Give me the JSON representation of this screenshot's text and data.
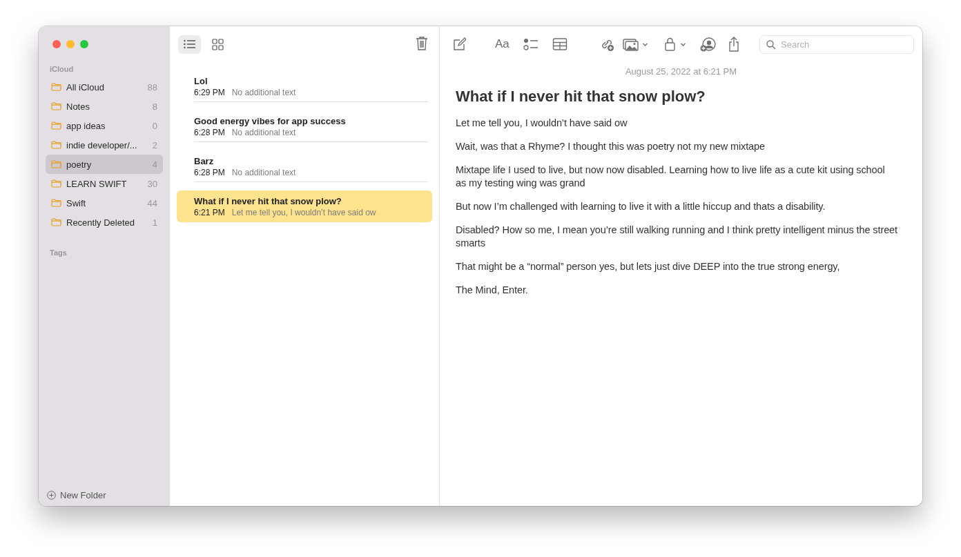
{
  "sidebar": {
    "section": "iCloud",
    "folders": [
      {
        "name": "All iCloud",
        "count": "88",
        "selected": false
      },
      {
        "name": "Notes",
        "count": "8",
        "selected": false
      },
      {
        "name": "app ideas",
        "count": "0",
        "selected": false
      },
      {
        "name": "indie developer/...",
        "count": "2",
        "selected": false
      },
      {
        "name": "poetry",
        "count": "4",
        "selected": true
      },
      {
        "name": "LEARN SWIFT",
        "count": "30",
        "selected": false
      },
      {
        "name": "Swift",
        "count": "44",
        "selected": false
      },
      {
        "name": "Recently Deleted",
        "count": "1",
        "selected": false
      }
    ],
    "tags_heading": "Tags",
    "new_folder": "New Folder"
  },
  "list_toolbar": {
    "views": [
      {
        "kind": "list",
        "selected": true
      },
      {
        "kind": "gallery",
        "selected": false
      }
    ]
  },
  "notes": [
    {
      "title": "Lol",
      "time": "6:29 PM",
      "preview": "No additional text",
      "selected": false
    },
    {
      "title": "Good energy vibes for app success",
      "time": "6:28 PM",
      "preview": "No additional text",
      "selected": false
    },
    {
      "title": "Barz",
      "time": "6:28 PM",
      "preview": "No additional text",
      "selected": false
    },
    {
      "title": "What if I never hit that snow plow?",
      "time": "6:21 PM",
      "preview": "Let me tell you, I wouldn’t have said ow",
      "selected": true
    }
  ],
  "editor_toolbar": {
    "format_label": "Aa",
    "search": {
      "placeholder": "Search"
    }
  },
  "note": {
    "date": "August 25, 2022 at 6:21 PM",
    "title": "What if I never hit that snow plow?",
    "paragraphs": [
      "Let me tell you, I wouldn’t have said ow",
      "Wait, was that a Rhyme? I thought this was poetry not my new mixtape",
      "Mixtape life I used to live, but now now disabled. Learning how to live life as a cute kit using school as my testing wing was grand",
      "But now I’m challenged with learning to live it with a little hiccup and thats a disability.",
      "Disabled? How so me, I mean you’re still walking running and I think pretty intelligent minus the street smarts",
      "That might be a “normal” person yes, but lets just dive DEEP into the true strong energy,",
      "The Mind, Enter."
    ]
  }
}
